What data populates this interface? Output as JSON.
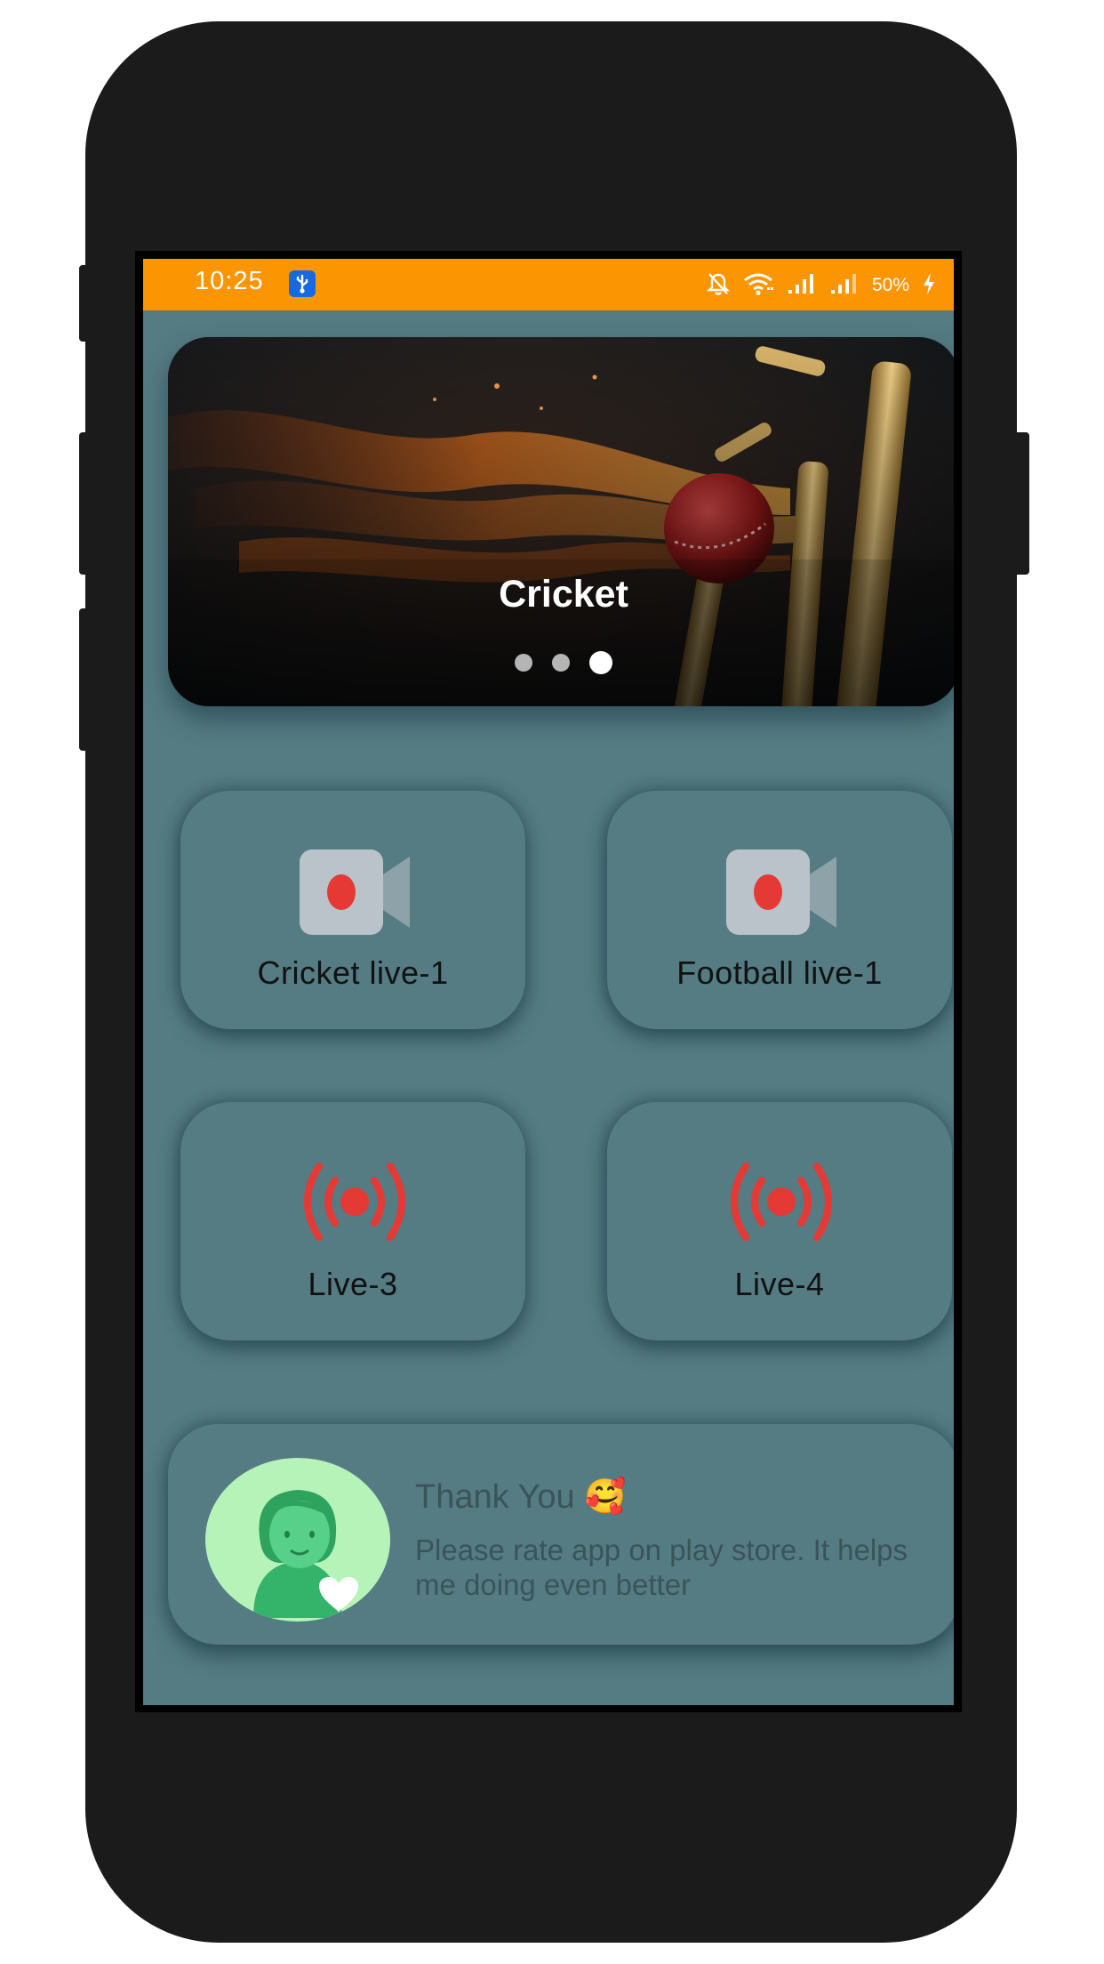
{
  "status_bar": {
    "time": "10:25",
    "battery": "50%",
    "usb_icon": "usb-debug-icon",
    "icons": [
      "mute-bell-icon",
      "wifi-icon",
      "signal-icon",
      "signal-icon",
      "charging-icon"
    ],
    "bg_color": "#fb9602"
  },
  "banner": {
    "title": "Cricket",
    "dots": 3,
    "active_dot": 3
  },
  "cards": [
    {
      "label": "Cricket live-1",
      "icon": "video-camera-icon"
    },
    {
      "label": "Football live-1",
      "icon": "video-camera-icon"
    },
    {
      "label": "Live-3",
      "icon": "live-broadcast-icon"
    },
    {
      "label": "Live-4",
      "icon": "live-broadcast-icon"
    }
  ],
  "rate": {
    "title": "Thank You 🥰",
    "subtitle": "Please rate app on play store. It helps me doing even better",
    "avatar_icon": "girl-with-heart-icon"
  },
  "colors": {
    "background": "#557b83",
    "accent_red": "#e53935",
    "avatar_bg": "#b6f3b9"
  }
}
